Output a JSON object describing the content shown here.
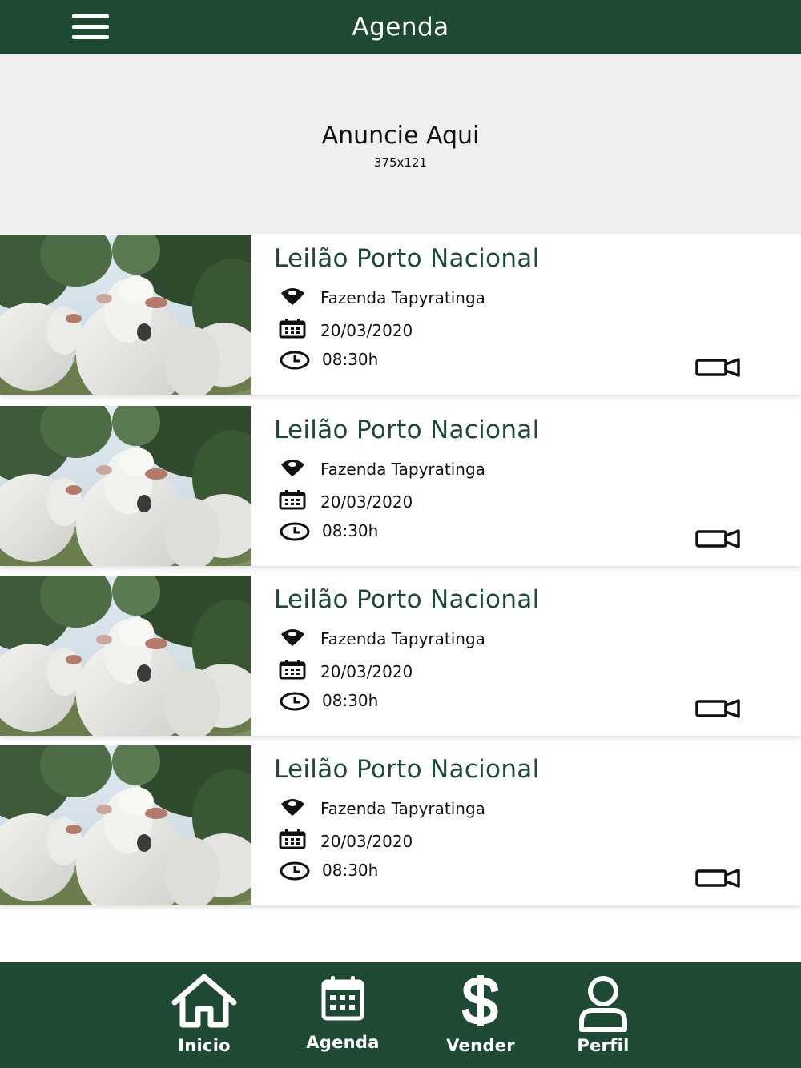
{
  "header": {
    "title": "Agenda",
    "menu_icon": "hamburger-menu-icon"
  },
  "ad_banner": {
    "title": "Anuncie Aqui",
    "size_label": "375x121"
  },
  "events": [
    {
      "title": "Leilão Porto Nacional",
      "location": "Fazenda Tapyratinga",
      "date": "20/03/2020",
      "time": "08:30h"
    },
    {
      "title": "Leilão Porto Nacional",
      "location": "Fazenda Tapyratinga",
      "date": "20/03/2020",
      "time": "08:30h"
    },
    {
      "title": "Leilão Porto Nacional",
      "location": "Fazenda Tapyratinga",
      "date": "20/03/2020",
      "time": "08:30h"
    },
    {
      "title": "Leilão Porto Nacional",
      "location": "Fazenda Tapyratinga",
      "date": "20/03/2020",
      "time": "08:30h"
    }
  ],
  "bottom_nav": {
    "items": [
      {
        "label": "Inicio",
        "icon": "home-icon"
      },
      {
        "label": "Agenda",
        "icon": "calendar-icon"
      },
      {
        "label": "Vender",
        "icon": "dollar-icon"
      },
      {
        "label": "Perfil",
        "icon": "user-icon"
      }
    ]
  },
  "colors": {
    "brand_green": "#1e4a33",
    "banner_gray": "#efefef",
    "text_dark": "#111111",
    "white": "#ffffff"
  }
}
